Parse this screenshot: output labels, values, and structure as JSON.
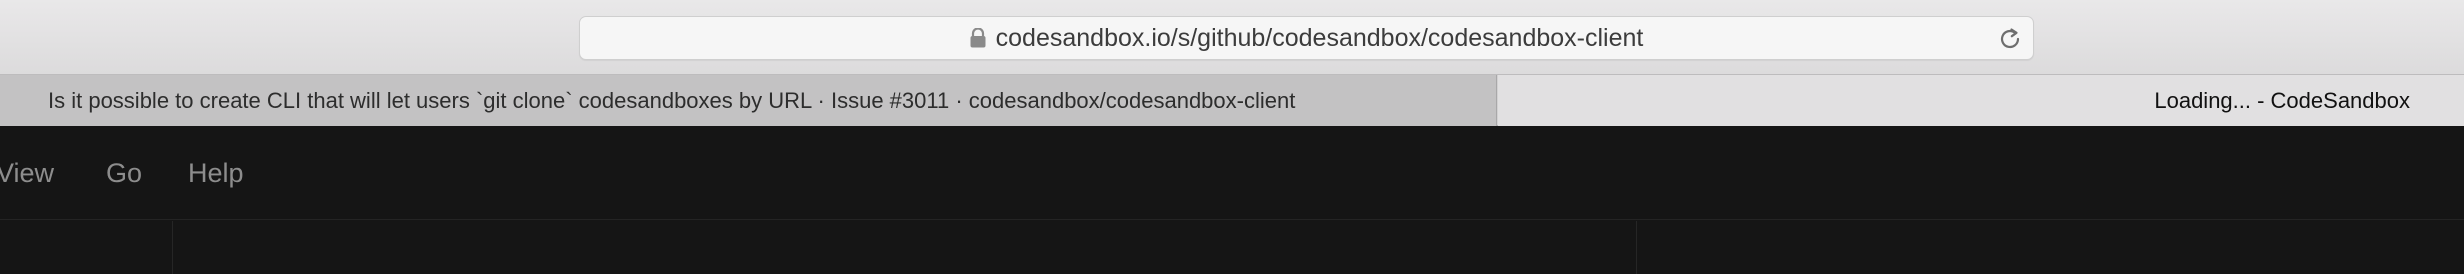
{
  "address_bar": {
    "url": "codesandbox.io/s/github/codesandbox/codesandbox-client",
    "lock_icon": "lock-icon",
    "reload_icon": "reload-icon"
  },
  "tabs": [
    {
      "title": "Is it possible to create CLI that will let users `git clone` codesandboxes by URL · Issue #3011 · codesandbox/codesandbox-client",
      "active": false
    },
    {
      "title": "Loading... - CodeSandbox",
      "active": true
    }
  ],
  "app": {
    "menu": {
      "items": [
        "View",
        "Go",
        "Help"
      ]
    }
  },
  "colors": {
    "app_background": "#151515",
    "menu_text": "#8d8d8d",
    "toolbar_background": "#e4e3e4",
    "active_tab": "#e1e0e1",
    "inactive_tab": "#c3c2c3"
  }
}
